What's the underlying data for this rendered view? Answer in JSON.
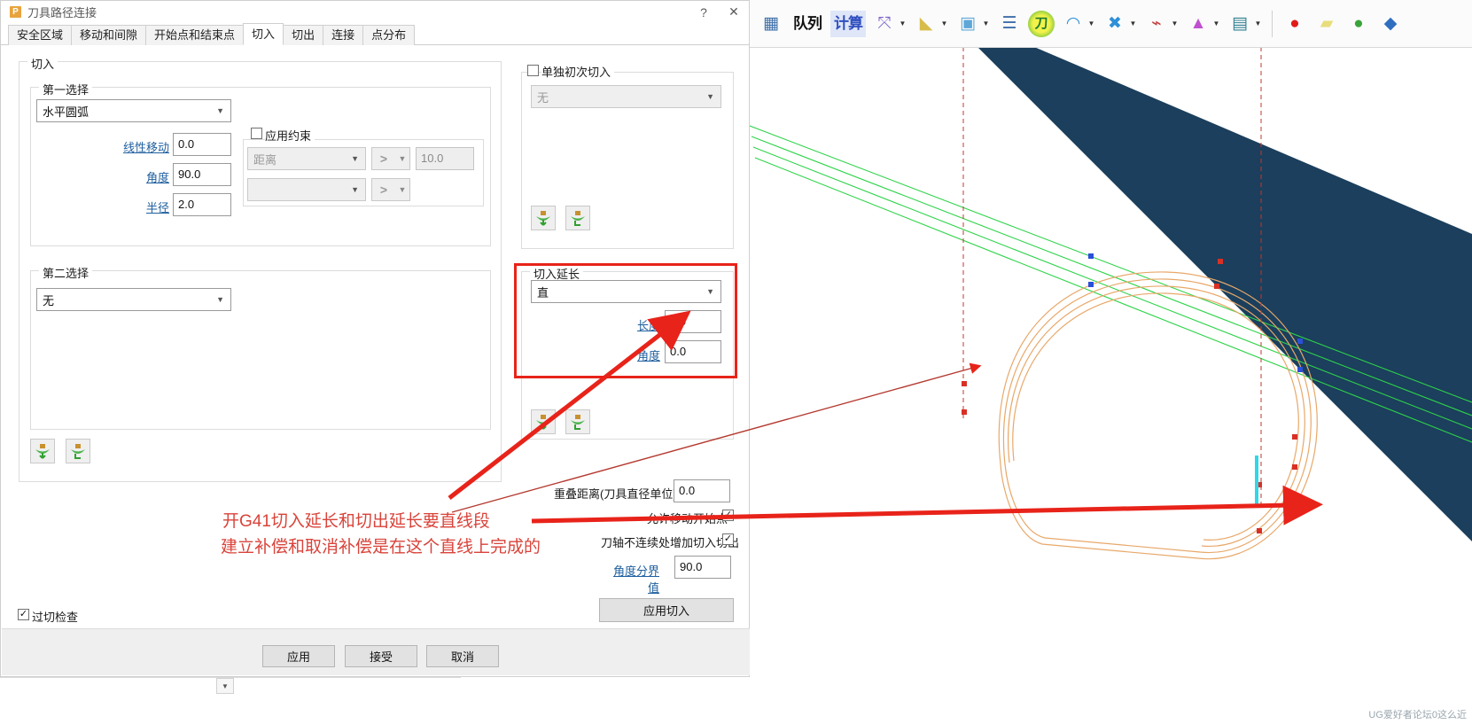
{
  "dialog": {
    "title": "刀具路径连接",
    "icon": "P",
    "help_btn": "?",
    "close_btn": "✕",
    "tabs": [
      {
        "label": "安全区域",
        "active": false
      },
      {
        "label": "移动和间隙",
        "active": false
      },
      {
        "label": "开始点和结束点",
        "active": false
      },
      {
        "label": "切入",
        "active": true
      },
      {
        "label": "切出",
        "active": false
      },
      {
        "label": "连接",
        "active": false
      },
      {
        "label": "点分布",
        "active": false
      }
    ],
    "lead_in_group": {
      "label": "切入",
      "first_choice": {
        "label": "第一选择",
        "type_select": "水平圆弧",
        "fields": [
          {
            "label": "线性移动",
            "value": "0.0"
          },
          {
            "label": "角度",
            "value": "90.0"
          },
          {
            "label": "半径",
            "value": "2.0"
          }
        ],
        "constraint": {
          "checkbox_label": "应用约束",
          "checked": false,
          "row1_select": "距离",
          "row1_op": ">",
          "row1_value": "10.0",
          "row2_select": "",
          "row2_op": ">"
        }
      },
      "second_choice": {
        "label": "第二选择",
        "type_select": "无"
      },
      "icon_buttons": [
        "lead-in-plant-forward-icon",
        "lead-in-plant-back-icon"
      ]
    },
    "separate_first_group": {
      "checkbox_label": "单独初次切入",
      "checked": false,
      "type_select": "无",
      "icon_buttons": [
        "first-lead-in-plant-forward-icon",
        "first-lead-in-plant-back-icon"
      ]
    },
    "extend_group": {
      "label": "切入延长",
      "type_select": "直",
      "fields": [
        {
          "label": "长度",
          "value": "1.0"
        },
        {
          "label": "角度",
          "value": "0.0"
        }
      ],
      "icon_buttons": [
        "extend-plant-forward-icon",
        "extend-plant-back-icon"
      ],
      "highlight_color": "#e8231a"
    },
    "options": {
      "overlap_label": "重叠距离(刀具直径单位)",
      "overlap_value": "0.0",
      "allow_move_start_label": "允许移动开始点",
      "allow_move_start_checked": true,
      "axis_discontinuity_label": "刀轴不连续处增加切入切出",
      "axis_discontinuity_checked": true,
      "angle_threshold_label": "角度分界值",
      "angle_threshold_value": "90.0",
      "apply_lead_in_button": "应用切入"
    },
    "gouge_check": {
      "label": "过切检查",
      "checked": true
    },
    "footer_buttons": [
      "应用",
      "接受",
      "取消"
    ]
  },
  "annotation": {
    "line1": "开G41切入延长和切出延长要直线段",
    "line2": "建立补偿和取消补偿是在这个直线上完成的",
    "color": "#d9433a"
  },
  "toolbar": {
    "items": [
      {
        "name": "calculator-icon",
        "glyph": "▦",
        "color": "#3d6fa8",
        "caret": false,
        "text": ""
      },
      {
        "name": "queue-text-icon",
        "glyph": "队列",
        "color": "#111111",
        "caret": false,
        "text": "队列"
      },
      {
        "name": "calculate-text-icon",
        "glyph": "计算",
        "color": "#2f4fbf",
        "caret": false,
        "text": "计算"
      },
      {
        "name": "csys-axis-icon",
        "glyph": "⤧",
        "color": "#7a63c8",
        "caret": true,
        "text": ""
      },
      {
        "name": "surface-icon",
        "glyph": "◣",
        "color": "#d8bc4a",
        "caret": true,
        "text": ""
      },
      {
        "name": "block-icon",
        "glyph": "▣",
        "color": "#5fa7d8",
        "caret": true,
        "text": ""
      },
      {
        "name": "list-icon",
        "glyph": "☰",
        "color": "#3f6ea8",
        "caret": false,
        "text": ""
      },
      {
        "name": "tool-knife-icon",
        "glyph": "刀",
        "color": "#1f8a3c",
        "caret": false,
        "text": ""
      },
      {
        "name": "boundary-loop-icon",
        "glyph": "◠",
        "color": "#2f8fd8",
        "caret": true,
        "text": ""
      },
      {
        "name": "pattern-star-icon",
        "glyph": "✖",
        "color": "#2f8fd8",
        "caret": true,
        "text": ""
      },
      {
        "name": "drill-tool-icon",
        "glyph": "⌁",
        "color": "#c33b3b",
        "caret": true,
        "text": ""
      },
      {
        "name": "stack-levels-icon",
        "glyph": "▲",
        "color": "#c050d0",
        "caret": true,
        "text": ""
      },
      {
        "name": "machine-icon",
        "glyph": "▤",
        "color": "#2f7f8f",
        "caret": true,
        "text": ""
      },
      {
        "name": "record-circle-icon",
        "glyph": "●",
        "color": "#e01b18",
        "caret": false,
        "text": ""
      },
      {
        "name": "plane-parallelogram-icon",
        "glyph": "▰",
        "color": "#e8dd7a",
        "caret": false,
        "text": ""
      },
      {
        "name": "sphere-green-icon",
        "glyph": "●",
        "color": "#3aa33a",
        "caret": false,
        "text": ""
      },
      {
        "name": "solid-blue-icon",
        "glyph": "◆",
        "color": "#2f6fbf",
        "caret": false,
        "text": ""
      }
    ]
  },
  "watermark": "UG爱好者论坛0这么近"
}
